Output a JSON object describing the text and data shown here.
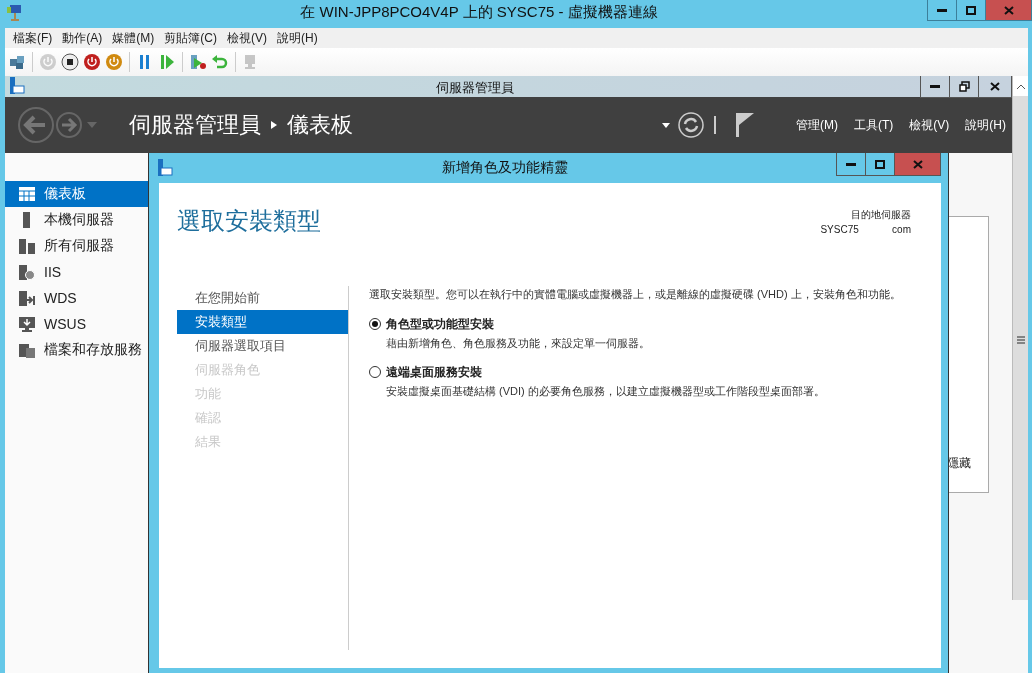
{
  "window": {
    "title": "在 WIN-JPP8PCO4V4P 上的 SYSC75 - 虛擬機器連線"
  },
  "menu": [
    "檔案(F)",
    "動作(A)",
    "媒體(M)",
    "剪貼簿(C)",
    "檢視(V)",
    "說明(H)"
  ],
  "toolbar": [
    {
      "kind": "ctrl",
      "disabled": false
    },
    {
      "kind": "sep"
    },
    {
      "kind": "start",
      "disabled": true
    },
    {
      "kind": "stop",
      "disabled": false
    },
    {
      "kind": "shutdown",
      "disabled": false
    },
    {
      "kind": "save",
      "disabled": false
    },
    {
      "kind": "sep"
    },
    {
      "kind": "pause",
      "disabled": false
    },
    {
      "kind": "resume",
      "disabled": false
    },
    {
      "kind": "sep"
    },
    {
      "kind": "checkpoint",
      "disabled": false
    },
    {
      "kind": "revert",
      "disabled": false
    },
    {
      "kind": "sep"
    },
    {
      "kind": "enhanced",
      "disabled": true
    }
  ],
  "server_manager": {
    "title": "伺服器管理員",
    "breadcrumb": [
      "伺服器管理員",
      "儀表板"
    ],
    "menu": [
      "管理(M)",
      "工具(T)",
      "檢視(V)",
      "說明(H)"
    ],
    "sidebar": [
      {
        "label": "儀表板",
        "selected": true
      },
      {
        "label": "本機伺服器",
        "selected": false
      },
      {
        "label": "所有伺服器",
        "selected": false
      },
      {
        "label": "IIS",
        "selected": false
      },
      {
        "label": "WDS",
        "selected": false
      },
      {
        "label": "WSUS",
        "selected": false
      },
      {
        "label": "檔案和存放服務",
        "selected": false
      }
    ],
    "panel_text": "隱藏"
  },
  "wizard": {
    "title": "新增角色及功能精靈",
    "heading": "選取安裝類型",
    "destination_label": "目的地伺服器",
    "destination_server": "SYSC75            com",
    "steps": [
      {
        "label": "在您開始前",
        "selected": false,
        "disabled": false
      },
      {
        "label": "安裝類型",
        "selected": true,
        "disabled": false
      },
      {
        "label": "伺服器選取項目",
        "selected": false,
        "disabled": false
      },
      {
        "label": "伺服器角色",
        "selected": false,
        "disabled": true
      },
      {
        "label": "功能",
        "selected": false,
        "disabled": true
      },
      {
        "label": "確認",
        "selected": false,
        "disabled": true
      },
      {
        "label": "結果",
        "selected": false,
        "disabled": true
      }
    ],
    "description": "選取安裝類型。您可以在執行中的實體電腦或虛擬機器上，或是離線的虛擬硬碟 (VHD) 上，安裝角色和功能。",
    "options": [
      {
        "title": "角色型或功能型安裝",
        "description": "藉由新增角色、角色服務及功能，來設定單一伺服器。",
        "selected": true
      },
      {
        "title": "遠端桌面服務安裝",
        "description": "安裝虛擬桌面基礎結構 (VDI) 的必要角色服務，以建立虛擬機器型或工作階段型桌面部署。",
        "selected": false
      }
    ]
  }
}
